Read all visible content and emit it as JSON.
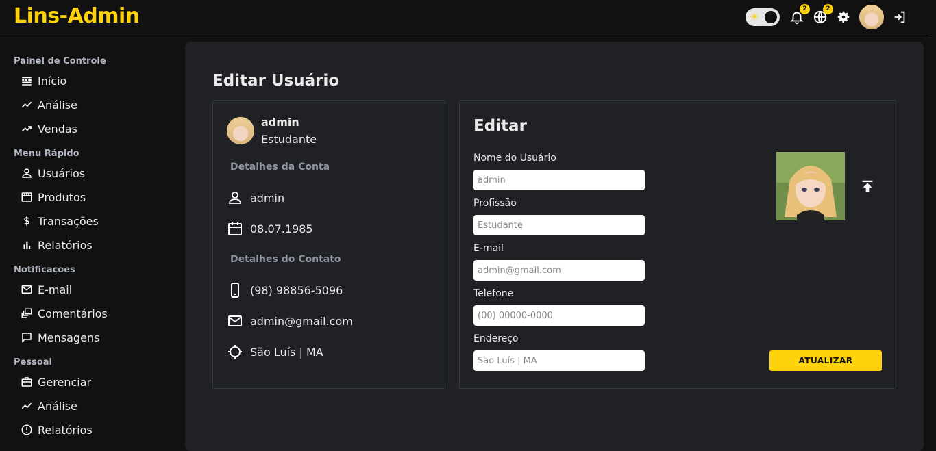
{
  "app": {
    "title": "Lins-Admin"
  },
  "topbar": {
    "notifications_count": "2",
    "language_count": "2"
  },
  "sidebar": {
    "sections": [
      {
        "title": "Painel de Controle",
        "items": [
          "Início",
          "Análise",
          "Vendas"
        ]
      },
      {
        "title": "Menu Rápido",
        "items": [
          "Usuários",
          "Produtos",
          "Transações",
          "Relatórios"
        ]
      },
      {
        "title": "Notificações",
        "items": [
          "E-mail",
          "Comentários",
          "Mensagens"
        ]
      },
      {
        "title": "Pessoal",
        "items": [
          "Gerenciar",
          "Análise",
          "Relatórios"
        ]
      }
    ]
  },
  "page": {
    "title": "Editar Usuário"
  },
  "profile": {
    "name": "admin",
    "role": "Estudante",
    "account_title": "Detalhes da Conta",
    "username": "admin",
    "birthdate": "08.07.1985",
    "contact_title": "Detalhes do Contato",
    "phone": "(98) 98856-5096",
    "email": "admin@gmail.com",
    "location": "São Luís | MA"
  },
  "edit": {
    "title": "Editar",
    "fields": [
      {
        "label": "Nome do Usuário",
        "placeholder": "admin"
      },
      {
        "label": "Profissão",
        "placeholder": "Estudante"
      },
      {
        "label": "E-mail",
        "placeholder": "admin@gmail.com"
      },
      {
        "label": "Telefone",
        "placeholder": "(00) 00000-0000"
      },
      {
        "label": "Endereço",
        "placeholder": "São Luís | MA"
      }
    ],
    "submit_label": "ATUALIZAR"
  },
  "colors": {
    "accent": "#fdd20a",
    "panel": "#1f2125",
    "background": "#111111"
  }
}
